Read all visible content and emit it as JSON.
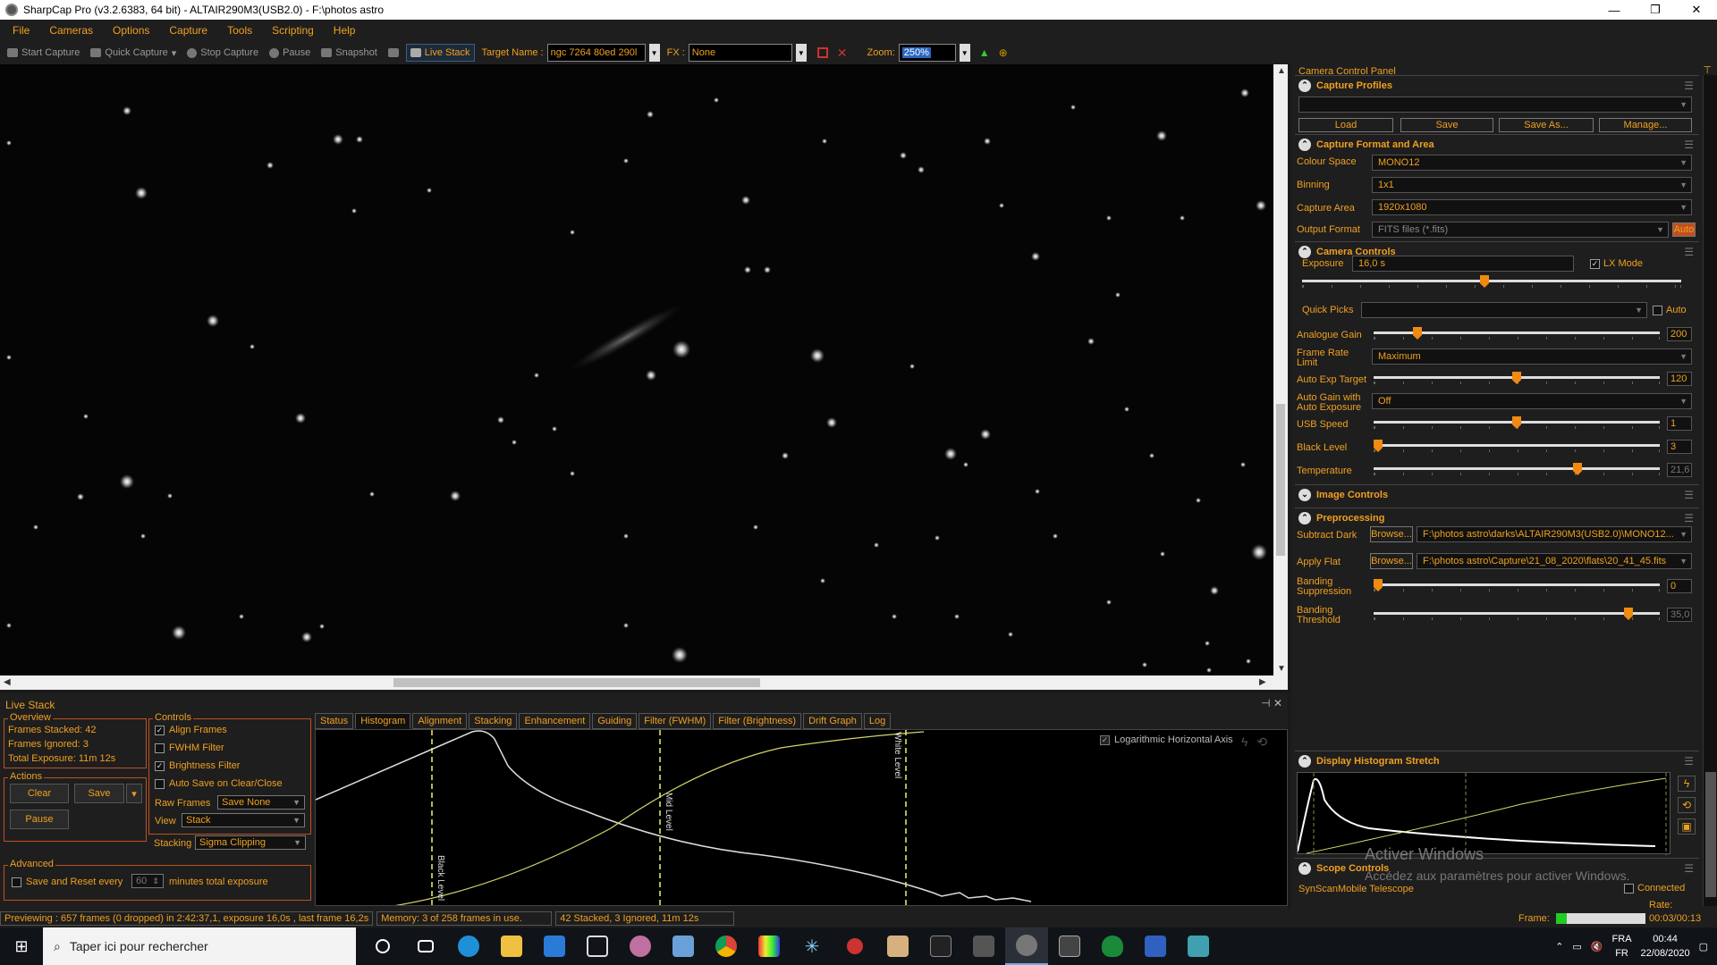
{
  "window": {
    "title": "SharpCap Pro (v3.2.6383, 64 bit) - ALTAIR290M3(USB2.0) - F:\\photos astro",
    "controls": [
      "—",
      "❐",
      "✕"
    ]
  },
  "menu": [
    "File",
    "Cameras",
    "Options",
    "Capture",
    "Tools",
    "Scripting",
    "Help"
  ],
  "toolbar": {
    "start_capture": "Start Capture",
    "quick_capture": "Quick Capture",
    "stop_capture": "Stop Capture",
    "pause": "Pause",
    "snapshot": "Snapshot",
    "live_stack": "Live Stack",
    "target_name_label": "Target Name :",
    "target_name_value": "ngc 7264 80ed 290l",
    "fx_label": "FX :",
    "fx_value": "None",
    "zoom_label": "Zoom:",
    "zoom_value": "250%"
  },
  "livestack": {
    "title": "Live Stack",
    "overview": {
      "title": "Overview",
      "frames_stacked": "Frames Stacked: 42",
      "frames_ignored": "Frames Ignored:  3",
      "total_exposure": "Total Exposure:  11m 12s"
    },
    "actions": {
      "title": "Actions",
      "clear": "Clear",
      "save": "Save",
      "pause": "Pause"
    },
    "controls": {
      "title": "Controls",
      "align_frames": "Align Frames",
      "fwhm_filter": "FWHM Filter",
      "brightness_filter": "Brightness Filter",
      "auto_save": "Auto Save on Clear/Close",
      "raw_frames_label": "Raw Frames",
      "raw_frames_value": "Save None",
      "view_label": "View",
      "view_value": "Stack",
      "stacking_label": "Stacking",
      "stacking_value": "Sigma Clipping"
    },
    "advanced": {
      "title": "Advanced",
      "save_reset": "Save and Reset every",
      "minutes_value": "60",
      "minutes_label": "minutes total exposure"
    },
    "tabs": [
      "Status",
      "Histogram",
      "Alignment",
      "Stacking",
      "Enhancement",
      "Guiding",
      "Filter (FWHM)",
      "Filter (Brightness)",
      "Drift Graph",
      "Log"
    ],
    "histogram": {
      "log_axis": "Logarithmic Horizontal Axis",
      "black_level": "Black Level",
      "mid_level": "Mid Level",
      "white_level": "White Level"
    }
  },
  "status": {
    "previewing": "Previewing : 657 frames (0 dropped) in 2:42:37,1, exposure 16,0s , last frame 16,2s",
    "memory": "Memory: 3 of 258 frames in use.",
    "stacked": "42 Stacked, 3 Ignored, 11m 12s",
    "frame_label": "Frame:",
    "time": "00:03/00:13"
  },
  "panel": {
    "title": "Camera Control Panel",
    "capture_profiles": {
      "title": "Capture Profiles",
      "load": "Load",
      "save": "Save",
      "save_as": "Save As...",
      "manage": "Manage..."
    },
    "format": {
      "title": "Capture Format and Area",
      "colour_space_label": "Colour Space",
      "colour_space": "MONO12",
      "binning_label": "Binning",
      "binning": "1x1",
      "capture_area_label": "Capture Area",
      "capture_area": "1920x1080",
      "output_format_label": "Output Format",
      "output_format": "FITS files (*.fits)",
      "auto": "Auto"
    },
    "camera": {
      "title": "Camera Controls",
      "exposure_label": "Exposure",
      "exposure": "16,0 s",
      "lx_mode": "LX Mode",
      "quick_picks_label": "Quick Picks",
      "auto": "Auto",
      "analogue_gain_label": "Analogue Gain",
      "analogue_gain": "200",
      "frame_rate_label": "Frame Rate Limit",
      "frame_rate": "Maximum",
      "auto_exp_label": "Auto Exp Target",
      "auto_exp": "120",
      "auto_gain_label": "Auto Gain with Auto Exposure",
      "auto_gain": "Off",
      "usb_speed_label": "USB Speed",
      "usb_speed": "1",
      "black_level_label": "Black Level",
      "black_level": "3",
      "temperature_label": "Temperature",
      "temperature": "21,6"
    },
    "image_controls": {
      "title": "Image Controls"
    },
    "preprocessing": {
      "title": "Preprocessing",
      "subtract_dark_label": "Subtract Dark",
      "browse": "Browse...",
      "subtract_dark": "F:\\photos astro\\darks\\ALTAIR290M3(USB2.0)\\MONO12...",
      "apply_flat_label": "Apply Flat",
      "apply_flat": "F:\\photos astro\\Capture\\21_08_2020\\flats\\20_41_45.fits",
      "banding_suppression_label": "Banding Suppression",
      "banding_suppression": "0",
      "banding_threshold_label": "Banding Threshold",
      "banding_threshold": "35,0"
    },
    "histogram_stretch": {
      "title": "Display Histogram Stretch"
    },
    "scope": {
      "title": "Scope Controls",
      "connected": "Connected",
      "device": "SynScanMobile Telescope",
      "rate": "Rate:"
    },
    "watermark_title": "Activer Windows",
    "watermark_sub": "Accédez aux paramètres pour activer Windows."
  },
  "taskbar": {
    "search": "Taper ici pour rechercher",
    "lang1": "FRA",
    "lang2": "FR",
    "time": "00:44",
    "date": "22/08/2020"
  },
  "colors": {
    "accent": "#f0a020",
    "background": "#1e1e1e",
    "knob": "#f08a10"
  }
}
